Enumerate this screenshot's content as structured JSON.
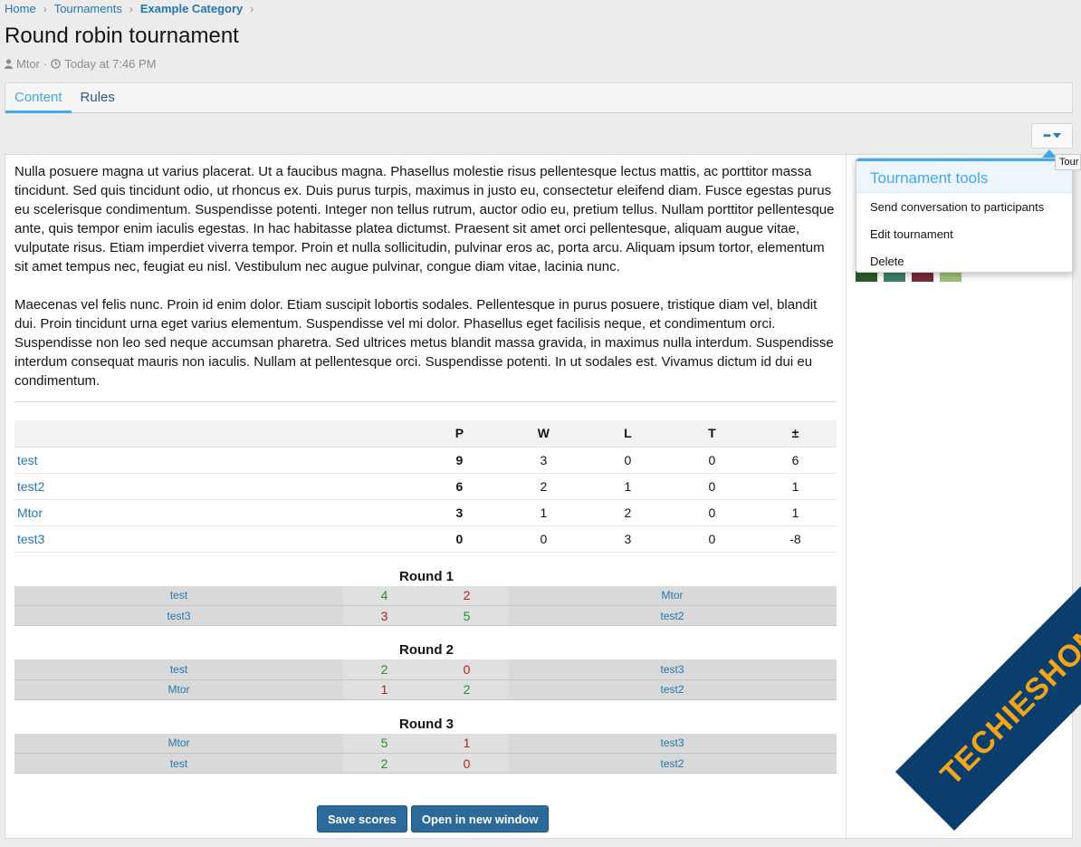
{
  "breadcrumb": {
    "home": "Home",
    "tournaments": "Tournaments",
    "category": "Example Category"
  },
  "title": "Round robin tournament",
  "meta": {
    "author": "Mtor",
    "separator": "·",
    "time": "Today at 7:46 PM"
  },
  "tabs": [
    {
      "label": "Content"
    },
    {
      "label": "Rules"
    }
  ],
  "tools_button": {
    "label": "•••"
  },
  "tooltip": "Tour",
  "content": {
    "paragraph1": "Nulla posuere magna ut varius placerat. Ut a faucibus magna. Phasellus molestie risus pellentesque lectus mattis, ac porttitor massa tincidunt. Sed quis tincidunt odio, ut rhoncus ex. Duis purus turpis, maximus in justo eu, consectetur eleifend diam. Fusce egestas purus eu scelerisque condimentum. Suspendisse potenti. Integer non tellus rutrum, auctor odio eu, pretium tellus. Nullam porttitor pellentesque ante, quis tempor enim iaculis egestas. In hac habitasse platea dictumst. Praesent sit amet orci pellentesque, aliquam augue vitae, vulputate risus. Etiam imperdiet viverra tempor. Proin et nulla sollicitudin, pulvinar eros ac, porta arcu. Aliquam ipsum tortor, elementum sit amet tempus nec, feugiat eu nisl. Vestibulum nec augue pulvinar, congue diam vitae, lacinia nunc.",
    "paragraph2": "Maecenas vel felis nunc. Proin id enim dolor. Etiam suscipit lobortis sodales. Pellentesque in purus posuere, tristique diam vel, blandit dui. Proin tincidunt urna eget varius elementum. Suspendisse vel mi dolor. Phasellus eget facilisis neque, et condimentum orci. Suspendisse non leo sed neque accumsan pharetra. Sed ultrices metus blandit massa gravida, in maximus nulla interdum. Suspendisse interdum consequat mauris non iaculis. Nullam at pellentesque orci. Suspendisse potenti. In ut sodales est. Vivamus dictum id dui eu condimentum."
  },
  "standings": {
    "headers": [
      "",
      "P",
      "W",
      "L",
      "T",
      "±"
    ],
    "rows": [
      {
        "name": "test",
        "p": "9",
        "w": "3",
        "l": "0",
        "t": "0",
        "diff": "6"
      },
      {
        "name": "test2",
        "p": "6",
        "w": "2",
        "l": "1",
        "t": "0",
        "diff": "1"
      },
      {
        "name": "Mtor",
        "p": "3",
        "w": "1",
        "l": "2",
        "t": "0",
        "diff": "1"
      },
      {
        "name": "test3",
        "p": "0",
        "w": "0",
        "l": "3",
        "t": "0",
        "diff": "-8"
      }
    ]
  },
  "rounds": [
    {
      "title": "Round 1",
      "matches": [
        {
          "home": "test",
          "home_score": "4",
          "away_score": "2",
          "away": "Mtor"
        },
        {
          "home": "test3",
          "home_score": "3",
          "away_score": "5",
          "away": "test2"
        }
      ]
    },
    {
      "title": "Round 2",
      "matches": [
        {
          "home": "test",
          "home_score": "2",
          "away_score": "0",
          "away": "test3"
        },
        {
          "home": "Mtor",
          "home_score": "1",
          "away_score": "2",
          "away": "test2"
        }
      ]
    },
    {
      "title": "Round 3",
      "matches": [
        {
          "home": "Mtor",
          "home_score": "5",
          "away_score": "1",
          "away": "test3"
        },
        {
          "home": "test",
          "home_score": "2",
          "away_score": "0",
          "away": "test2"
        }
      ]
    }
  ],
  "buttons": {
    "save": "Save scores",
    "open": "Open in new window"
  },
  "menu": {
    "header": "Tournament tools",
    "items": [
      "Send conversation to participants",
      "Edit tournament",
      "Delete"
    ]
  },
  "watermark": "TECHIESHOME.COM",
  "colors": {
    "link": "#2577b1",
    "accent": "#47a7eb",
    "win": "#2d8a2d",
    "loss": "#b02020",
    "button": "#2b6a99",
    "watermark_band": "#0b3e6c",
    "watermark_text": "#f2a518"
  }
}
